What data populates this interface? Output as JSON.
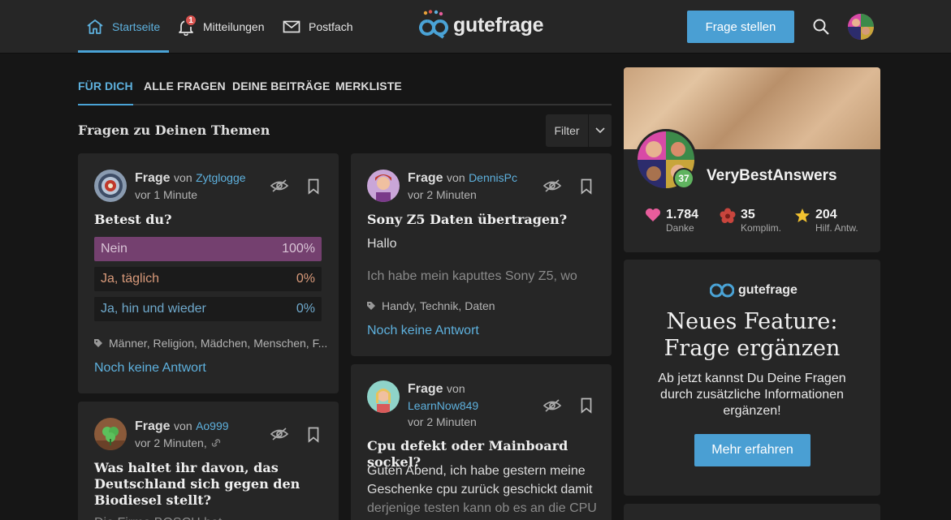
{
  "header": {
    "nav": {
      "home": "Startseite",
      "notifications": "Mitteilungen",
      "notifications_count": "1",
      "inbox": "Postfach"
    },
    "logo": "gutefrage",
    "ask_button": "Frage stellen"
  },
  "tabs": [
    "FÜR DICH",
    "ALLE FRAGEN",
    "DEINE BEITRÄGE",
    "MERKLISTE"
  ],
  "section_title": "Fragen zu Deinen Themen",
  "filter_label": "Filter",
  "questions": [
    {
      "kind": "Frage",
      "von": "von",
      "user": "Zytglogge",
      "time": "vor 1 Minute",
      "title": "Betest du?",
      "poll": [
        {
          "label": "Nein",
          "percent": "100%"
        },
        {
          "label": "Ja, täglich",
          "percent": "0%"
        },
        {
          "label": "Ja, hin und wieder",
          "percent": "0%"
        }
      ],
      "tags": "Männer, Religion, Mädchen, Menschen, F...",
      "answer_status": "Noch keine Antwort"
    },
    {
      "kind": "Frage",
      "von": "von",
      "user": "DennisPc",
      "time": "vor 2 Minuten",
      "title": "Sony Z5 Daten übertragen?",
      "body1": "Hallo",
      "body2": "Ich habe mein kaputtes Sony Z5, wo",
      "tags": "Handy, Technik, Daten",
      "answer_status": "Noch keine Antwort"
    },
    {
      "kind": "Frage",
      "von": "von",
      "user": "Ao999",
      "time": "vor 2 Minuten,",
      "title": "Was haltet ihr davon, das Deutschland sich gegen den Biodiesel stellt?",
      "body_partial": "Die Firma BOSCH hat ..."
    },
    {
      "kind": "Frage",
      "von": "von",
      "user": "LearnNow849",
      "time": "vor 2 Minuten",
      "title": "Cpu defekt oder Mainboard sockel?",
      "body": [
        "Guten Abend, ich habe gestern meine",
        "Geschenke cpu zurück geschickt damit",
        "derjenige testen kann ob es an die CPU"
      ]
    }
  ],
  "profile": {
    "name": "VeryBestAnswers",
    "level": "37",
    "stats": [
      {
        "value": "1.784",
        "label": "Danke",
        "icon": "heart-icon",
        "color": "#e85d9c"
      },
      {
        "value": "35",
        "label": "Komplim.",
        "icon": "flower-icon",
        "color": "#c9453d"
      },
      {
        "value": "204",
        "label": "Hilf. Antw.",
        "icon": "star-icon",
        "color": "#f2c230"
      }
    ]
  },
  "feature": {
    "logo": "gutefrage",
    "title_line1": "Neues Feature:",
    "title_line2": "Frage ergänzen",
    "description": "Ab jetzt kannst Du Deine Fragen durch zusätzliche Informationen ergänzen!",
    "button": "Mehr erfahren"
  },
  "colors": {
    "accent": "#4a9fd3",
    "link": "#5eb1de",
    "poll_winner": "#74406f",
    "background": "#161616",
    "card": "#262626"
  }
}
